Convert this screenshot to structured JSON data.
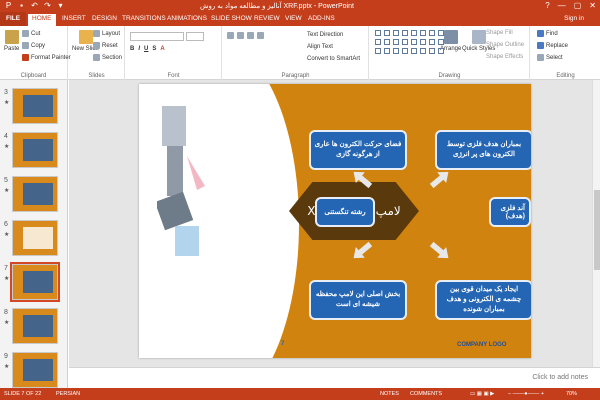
{
  "titlebar": {
    "title": "آنالیز و مطالعه مواد به روش XRF.pptx - PowerPoint",
    "minimize": "—",
    "restore": "▢",
    "close": "✕",
    "help": "?"
  },
  "tabs": [
    {
      "label": "FILE"
    },
    {
      "label": "HOME"
    },
    {
      "label": "INSERT"
    },
    {
      "label": "DESIGN"
    },
    {
      "label": "TRANSITIONS"
    },
    {
      "label": "ANIMATIONS"
    },
    {
      "label": "SLIDE SHOW"
    },
    {
      "label": "REVIEW"
    },
    {
      "label": "VIEW"
    },
    {
      "label": "ADD-INS"
    }
  ],
  "signin": "Sign in",
  "ribbon": {
    "clipboard": {
      "label": "Clipboard",
      "paste": "Paste",
      "cut": "Cut",
      "copy": "Copy",
      "format_painter": "Format Painter"
    },
    "slides": {
      "label": "Slides",
      "new_slide": "New Slide",
      "layout": "Layout",
      "reset": "Reset",
      "section": "Section"
    },
    "font": {
      "label": "Font"
    },
    "paragraph": {
      "label": "Paragraph",
      "text_direction": "Text Direction",
      "align_text": "Align Text",
      "convert": "Convert to SmartArt"
    },
    "drawing": {
      "label": "Drawing",
      "arrange": "Arrange",
      "quick_styles": "Quick Styles",
      "shape_fill": "Shape Fill",
      "shape_outline": "Shape Outline",
      "shape_effects": "Shape Effects"
    },
    "editing": {
      "label": "Editing",
      "find": "Find",
      "replace": "Replace",
      "select": "Select"
    }
  },
  "thumbnails": [
    {
      "num": "3"
    },
    {
      "num": "4"
    },
    {
      "num": "5"
    },
    {
      "num": "6"
    },
    {
      "num": "7"
    },
    {
      "num": "8"
    },
    {
      "num": "9"
    }
  ],
  "slide": {
    "center_title": "لامپ تولید اشعه X",
    "box_top_left": "فضای حرکت الکترون ها عاری از هرگونه گازی",
    "box_top_right": "بمباران هدف فلزی توسط الکترون های پر انرژی",
    "box_bottom_left": "بخش اصلی این لامپ محفظه شیشه ای است",
    "box_bottom_right": "ایجاد یک میدان قوی بین چشمه ی الکترونی و هدف بمباران شونده",
    "side_left": "رشته تنگستنی",
    "side_right": "آند فلزی (هدف)",
    "slide_number": "7",
    "logo": "COMPANY LOGO"
  },
  "notes_placeholder": "Click to add notes",
  "status": {
    "slide_info": "SLIDE 7 OF 22",
    "language": "PERSIAN",
    "notes": "NOTES",
    "comments": "COMMENTS",
    "zoom": "70%"
  },
  "colors": {
    "accent": "#c43e1c",
    "slide_orange": "#d1830f",
    "box_blue": "#2566b4"
  }
}
